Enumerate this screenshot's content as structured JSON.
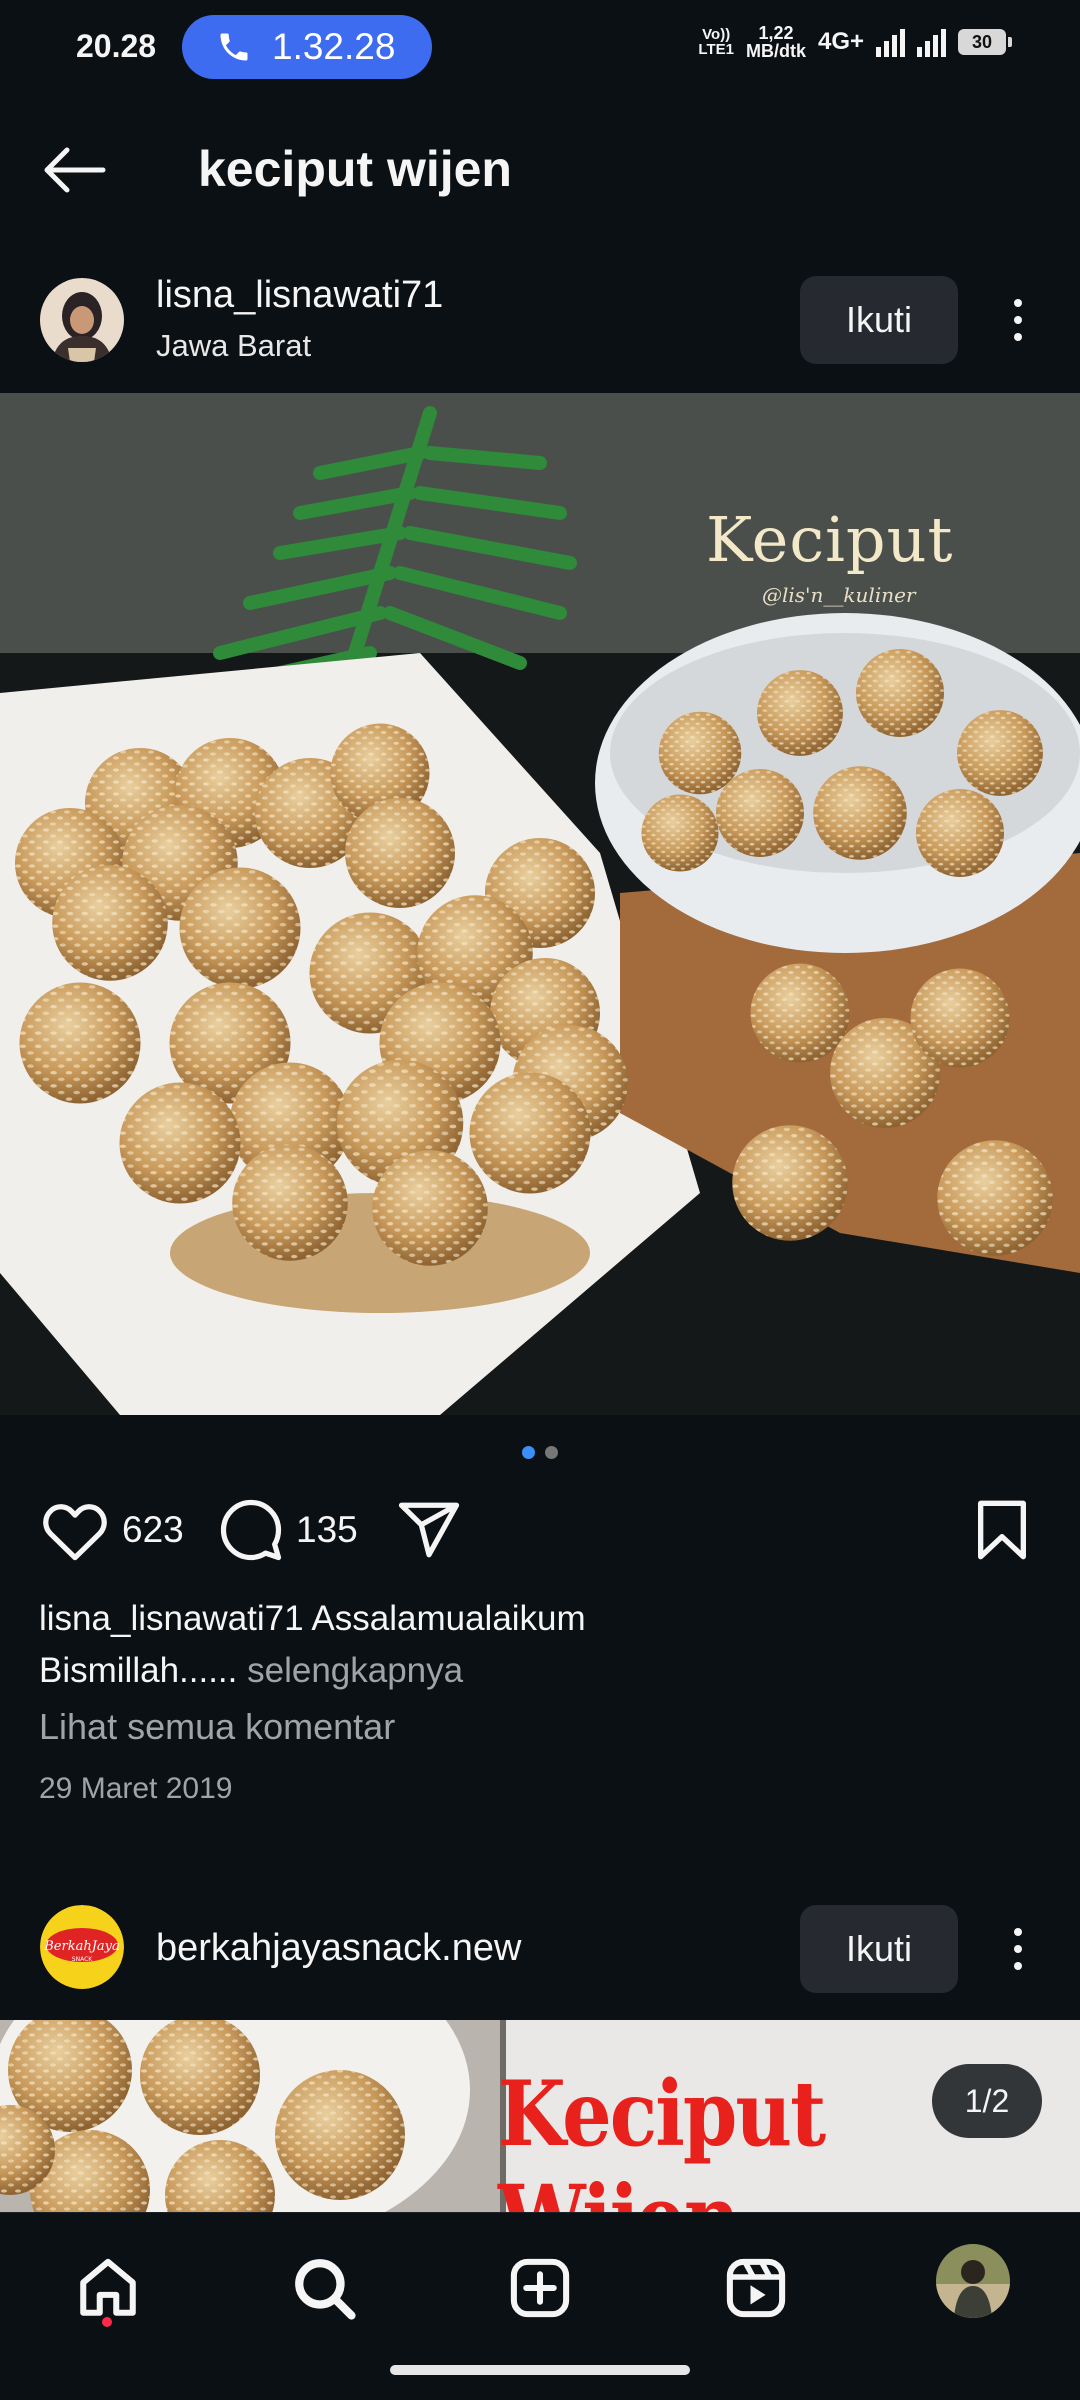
{
  "status_bar": {
    "time": "20.28",
    "call_duration": "1.32.28",
    "volte_top": "Vo))",
    "volte_bottom": "LTE1",
    "speed_value": "1,22",
    "speed_unit": "MB/dtk",
    "network": "4G+",
    "battery": "30"
  },
  "header": {
    "title": "keciput wijen",
    "back_icon": "arrow-left-icon"
  },
  "post1": {
    "username": "lisna_lisnawati71",
    "location": "Jawa Barat",
    "follow_label": "Ikuti",
    "photo_overlay_title": "Keciput",
    "photo_overlay_handle": "@lis'n__kuliner",
    "carousel_pages": 2,
    "carousel_active": 1,
    "likes": "623",
    "comments": "135",
    "caption_user": "lisna_lisnawati71",
    "caption_text_1": " Assalamualaikum",
    "caption_text_2": "Bismillah......",
    "caption_more": " selengkapnya",
    "view_comments": "Lihat semua komentar",
    "date": "29 Maret 2019"
  },
  "post2": {
    "username": "berkahjayasnack.new",
    "avatar_text": "BerkahJaya",
    "avatar_subtext": "SNACK",
    "follow_label": "Ikuti",
    "banner_text": "Keciput Wijen",
    "page_counter": "1/2"
  },
  "bottom_nav": {
    "items": [
      "home-icon",
      "search-icon",
      "create-icon",
      "reels-icon",
      "profile-avatar"
    ]
  },
  "colors": {
    "background": "#0b1014",
    "call_pill": "#3d6cf0",
    "carousel_active": "#3b8ff5",
    "banner_red": "#e8211c",
    "nav_dot": "#ff2a4a"
  }
}
